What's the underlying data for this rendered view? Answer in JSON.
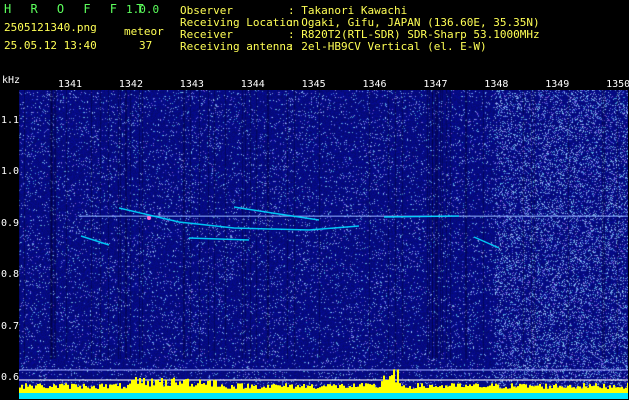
{
  "app": {
    "name": "H R O F F T",
    "version": "1.0.0",
    "filename": "2505121340.png",
    "datetime": "25.05.12 13:40",
    "meteor_label": "meteor",
    "meteor_count": "37"
  },
  "info": {
    "rows": [
      {
        "label": "Observer",
        "value": ": Takanori Kawachi"
      },
      {
        "label": "Receiving Location",
        "value": ": Ogaki, Gifu, JAPAN (136.60E, 35.35N)"
      },
      {
        "label": "Receiver",
        "value": ": R820T2(RTL-SDR) SDR-Sharp 53.1000MHz"
      },
      {
        "label": "Receiving antenna",
        "value": ": 2el-HB9CV Vertical (el. E-W)"
      }
    ]
  },
  "chart_data": {
    "type": "heatmap",
    "y_unit": "kHz",
    "x_ticks": [
      "1341",
      "1342",
      "1343",
      "1344",
      "1345",
      "1346",
      "1347",
      "1348",
      "1349",
      "1350"
    ],
    "y_ticks": [
      "1.1",
      "1.0",
      "0.9",
      "0.8",
      "0.7",
      "0.6"
    ],
    "ylim": [
      0.56,
      1.16
    ],
    "carrier_khz": 0.915
  },
  "colors": {
    "background": "#000000",
    "plot_bg": "#050a7a",
    "brand": "#5cff5c",
    "text": "#ffffff",
    "meteor_trace": "#00d8ff",
    "histogram_bar": "#ffff00",
    "histogram_base": "#00e5ff"
  }
}
